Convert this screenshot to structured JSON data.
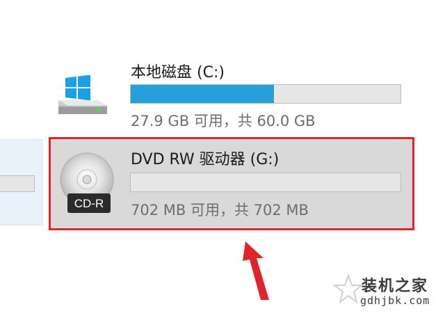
{
  "drives": {
    "c": {
      "title": "本地磁盘 (C:)",
      "usage_fraction": 0.53,
      "space_text": "27.9 GB 可用，共 60.0 GB",
      "icon": "windows-hdd-icon"
    },
    "g": {
      "title": "DVD RW 驱动器 (G:)",
      "usage_fraction": 0,
      "space_text": "702 MB 可用，共 702 MB",
      "icon": "cd-r-disc-icon",
      "icon_label": "CD-R"
    }
  },
  "watermark": {
    "title": "装机之家",
    "url": "gdhjbk.com"
  },
  "colors": {
    "bar_fill": "#26a0da",
    "highlight_border": "#e0242b",
    "arrow": "#e0242b",
    "selected_bg": "#d9d9d9"
  }
}
